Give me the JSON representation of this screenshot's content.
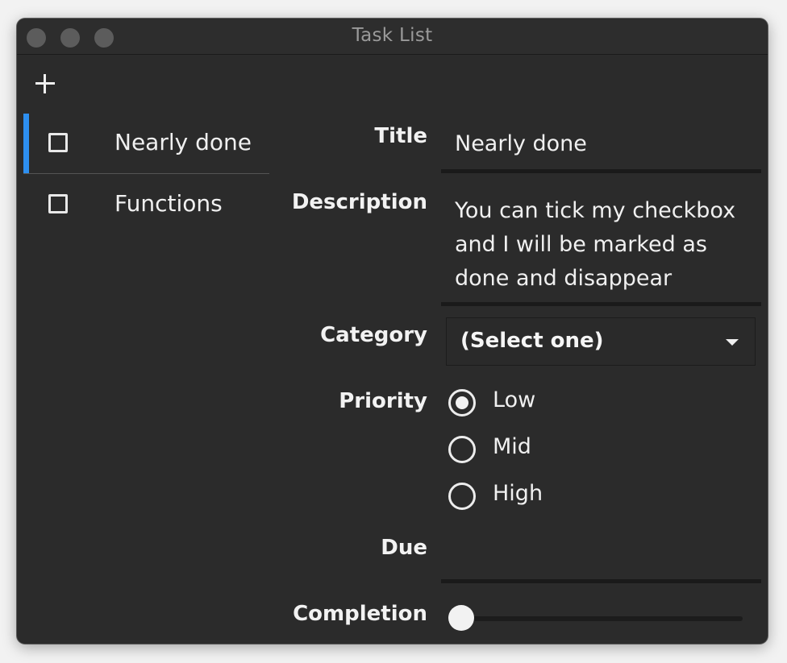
{
  "window": {
    "title": "Task List"
  },
  "toolbar": {
    "add_icon": "plus-icon"
  },
  "tasks": [
    {
      "label": "Nearly done",
      "checked": false,
      "selected": true
    },
    {
      "label": "Functions",
      "checked": false,
      "selected": false
    }
  ],
  "form": {
    "title_label": "Title",
    "title_value": "Nearly done",
    "description_label": "Description",
    "description_value": "You can tick my checkbox and I will be marked as done and disappear",
    "category_label": "Category",
    "category_value": "(Select one)",
    "priority_label": "Priority",
    "priority_options": [
      {
        "label": "Low",
        "selected": true
      },
      {
        "label": "Mid",
        "selected": false
      },
      {
        "label": "High",
        "selected": false
      }
    ],
    "due_label": "Due",
    "due_value": "",
    "completion_label": "Completion",
    "completion_value": 0
  },
  "colors": {
    "accent": "#2d8ff0",
    "background": "#2b2b2b"
  }
}
